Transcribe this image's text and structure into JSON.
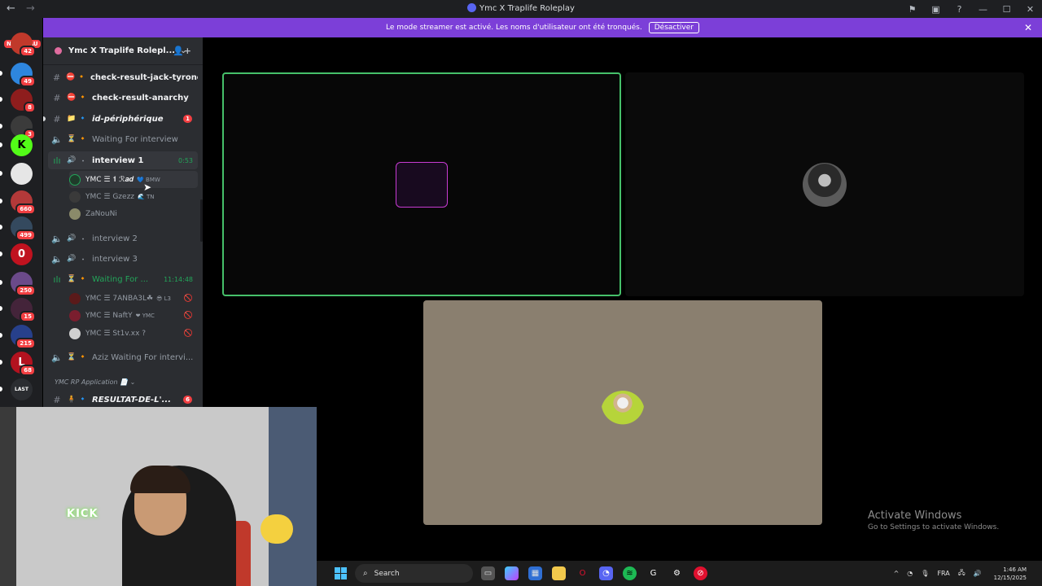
{
  "window": {
    "title": "Ymc X Traplife Roleplay",
    "back_icon": "←",
    "forward_icon": "→"
  },
  "server_list": {
    "new_badge": "NOUVEAU",
    "servers": [
      {
        "badge": "42",
        "color": "#c0392b"
      },
      {
        "badge": "49",
        "color": "#2e86de"
      },
      {
        "badge": "8",
        "color": "#8e1d1d"
      },
      {
        "badge": "3",
        "color": "#3b3b3b"
      },
      {
        "badge": "",
        "color": "#53fc18",
        "glyph": "K"
      },
      {
        "badge": "",
        "color": "#e6e6e6"
      },
      {
        "badge": "660",
        "color": "#b33939"
      },
      {
        "badge": "499",
        "color": "#34495e"
      },
      {
        "badge": "",
        "color": "#c0121f",
        "glyph": "0"
      },
      {
        "badge": "250",
        "color": "#6b4a8a"
      },
      {
        "badge": "15",
        "color": "#44243a"
      },
      {
        "badge": "215",
        "color": "#27408b"
      },
      {
        "badge": "68",
        "color": "#b3121f",
        "glyph": "L"
      },
      {
        "badge": "",
        "color": "#2b2d31",
        "glyph": "LAST"
      }
    ]
  },
  "banner": {
    "text": "Le mode streamer est activé. Les noms d'utilisateur ont été tronqués.",
    "button": "Désactiver",
    "close": "✕"
  },
  "guild": {
    "name": "Ymc X Traplife Rolepl...",
    "chevron": "⌄",
    "invite_icon": "👤+"
  },
  "channels": [
    {
      "kind": "text",
      "emoji": "⛔",
      "dot": "🔸",
      "label": "check-result-jack-tyrone",
      "bold": true
    },
    {
      "kind": "text",
      "emoji": "⛔",
      "dot": "🔸",
      "label": "check-result-anarchy",
      "bold": true
    },
    {
      "kind": "text",
      "emoji": "📁",
      "dot": "🔹",
      "label": "id-périphérique",
      "bold": true,
      "italic": true,
      "count": "1"
    },
    {
      "kind": "voice",
      "emoji": "⏳",
      "dot": "🔸",
      "label": "Waiting For interview"
    },
    {
      "kind": "voice-live",
      "emoji": "🔊",
      "dot": "・",
      "label": "interview 1",
      "bold": true,
      "timer": "0:53"
    },
    {
      "kind": "voice",
      "emoji": "🔊",
      "dot": "・",
      "label": "interview 2"
    },
    {
      "kind": "voice",
      "emoji": "🔊",
      "dot": "・",
      "label": "interview 3"
    },
    {
      "kind": "voice-live",
      "emoji": "⏳",
      "dot": "🔸",
      "label": "Waiting For ...",
      "green": true,
      "timer": "11:14:48"
    },
    {
      "kind": "voice",
      "emoji": "⏳",
      "dot": "🔸",
      "label": "Aziz Waiting For intervi..."
    }
  ],
  "members_interview1": [
    {
      "name": "YMC ☰ 𝟏 ℛ𝒂𝒅",
      "tag": "💙 BMW",
      "hover": true
    },
    {
      "name": "YMC ☰ Gzezz",
      "tag": "🌊 TN"
    },
    {
      "name": "ZaNouNi",
      "tag": ""
    }
  ],
  "members_waiting": [
    {
      "name": "YMC ☰ 7ANBA3L☘",
      "tag": "😎 L3"
    },
    {
      "name": "YMC ☰ NaftY",
      "tag": "❤ YMC"
    },
    {
      "name": "YMC ☰ St1v.xx ?",
      "tag": ""
    }
  ],
  "category": {
    "label": "YMC RP Application 📄",
    "chevron": "⌄"
  },
  "last_channel": {
    "label": "RESULTAT-DE-L'...",
    "count": "6"
  },
  "watermark": {
    "line1": "Activate Windows",
    "line2": "Go to Settings to activate Windows."
  },
  "webcam": {
    "sign": "KICK"
  },
  "taskbar": {
    "search": "Search",
    "language": "FRA",
    "time": "1:46 AM",
    "date": "12/15/2025"
  }
}
